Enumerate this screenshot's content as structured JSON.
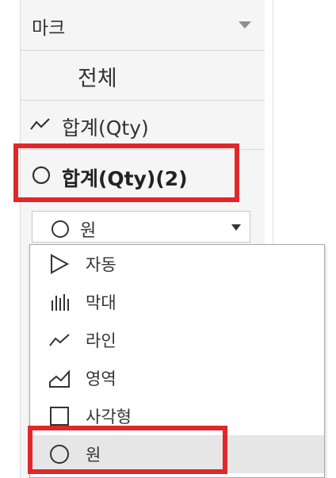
{
  "marks_card": {
    "header_label": "마크",
    "rows": {
      "all": "전체",
      "qty_line": "합계(Qty)",
      "qty_circle": "합계(Qty)(2)"
    },
    "mark_type_select": {
      "selected": "원",
      "selected_icon": "circle-icon"
    }
  },
  "mark_type_menu": {
    "items": [
      {
        "label": "자동",
        "icon": "automatic-triangle-icon",
        "selected": false
      },
      {
        "label": "막대",
        "icon": "bar-icon",
        "selected": false
      },
      {
        "label": "라인",
        "icon": "line-icon",
        "selected": false
      },
      {
        "label": "영역",
        "icon": "area-icon",
        "selected": false
      },
      {
        "label": "사각형",
        "icon": "square-icon",
        "selected": false
      },
      {
        "label": "원",
        "icon": "circle-icon",
        "selected": true
      }
    ]
  },
  "colors": {
    "highlight": "#e0282b",
    "panel_bg": "#f5f5f5",
    "menu_selected_bg": "#e6e6e6"
  }
}
